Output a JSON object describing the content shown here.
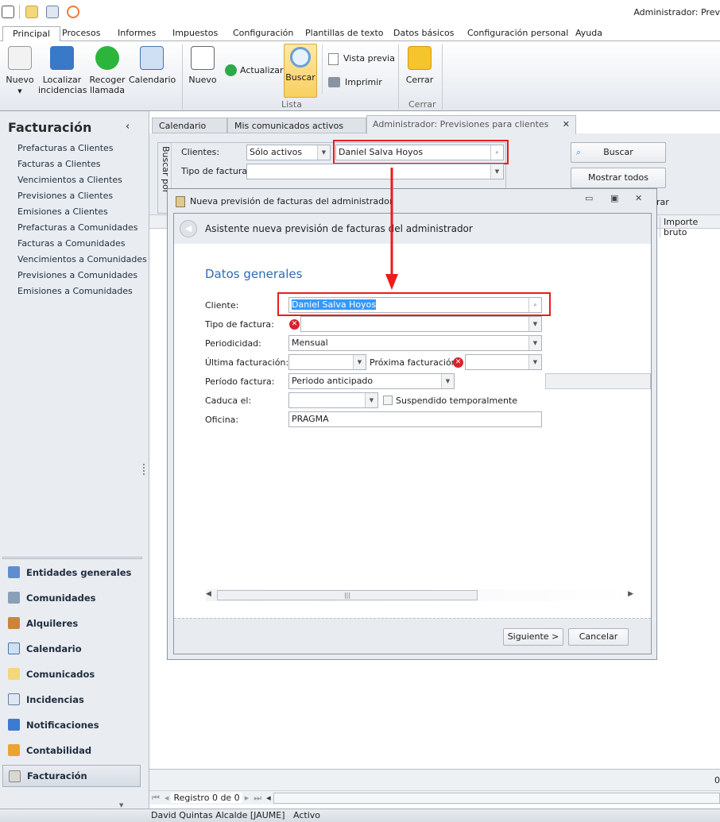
{
  "window_title": "Administrador: Prev",
  "ribbon_tabs": [
    "Principal",
    "Procesos",
    "Informes",
    "Impuestos",
    "Configuración",
    "Plantillas de texto",
    "Datos básicos",
    "Configuración personal",
    "Ayuda"
  ],
  "ribbon": {
    "nuevo": "Nuevo",
    "localizar": "Localizar",
    "incidencias": "incidencias",
    "recoger": "Recoger",
    "llamada": "llamada",
    "calendario": "Calendario",
    "nuevo2": "Nuevo",
    "actualizar": "Actualizar",
    "buscar": "Buscar",
    "vista_previa": "Vista previa",
    "imprimir": "Imprimir",
    "lista": "Lista",
    "cerrar": "Cerrar",
    "cerrar_group": "Cerrar"
  },
  "sidebar": {
    "title": "Facturación",
    "items": [
      "Prefacturas a Clientes",
      "Facturas a Clientes",
      "Vencimientos a Clientes",
      "Previsiones a Clientes",
      "Emisiones a Clientes",
      "Prefacturas a Comunidades",
      "Facturas a Comunidades",
      "Vencimientos a Comunidades",
      "Previsiones a Comunidades",
      "Emisiones a Comunidades"
    ],
    "nav": [
      "Entidades generales",
      "Comunidades",
      "Alquileres",
      "Calendario",
      "Comunicados",
      "Incidencias",
      "Notificaciones",
      "Contabilidad",
      "Facturación"
    ]
  },
  "doc_tabs": [
    "Calendario",
    "Mis comunicados activos",
    "Administrador: Previsiones para clientes"
  ],
  "search": {
    "group": "Buscar por",
    "clientes_label": "Clientes:",
    "clientes_filter": "Sólo activos",
    "clientes_value": "Daniel Salva Hoyos",
    "tipo_label": "Tipo de factura:",
    "buscar": "Buscar",
    "mostrar_todos": "Mostrar todos",
    "partial": "rar"
  },
  "grid": {
    "col_importe": "Importe bruto",
    "footer_value": "0",
    "nav_text": "Registro 0 de 0"
  },
  "dialog": {
    "title": "Nueva previsión de facturas del administrador",
    "header": "Asistente nueva previsión de facturas del administrador",
    "section": "Datos generales",
    "cliente_label": "Cliente:",
    "cliente": "Daniel Salva Hoyos",
    "tipo_label": "Tipo de factura:",
    "tipo": "",
    "periodicidad_label": "Periodicidad:",
    "periodicidad": "Mensual",
    "ultima_label": "Última facturación:",
    "proxima_label": "Próxima facturación:",
    "periodo_label": "Período factura:",
    "periodo": "Periodo anticipado",
    "caduca_label": "Caduca el:",
    "suspendido": "Suspendido temporalmente",
    "oficina_label": "Oficina:",
    "oficina": "PRAGMA",
    "siguiente": "Siguiente >",
    "cancelar": "Cancelar"
  },
  "status": {
    "user": "David Quintas Alcalde [JAUME]",
    "state": "Activo"
  }
}
